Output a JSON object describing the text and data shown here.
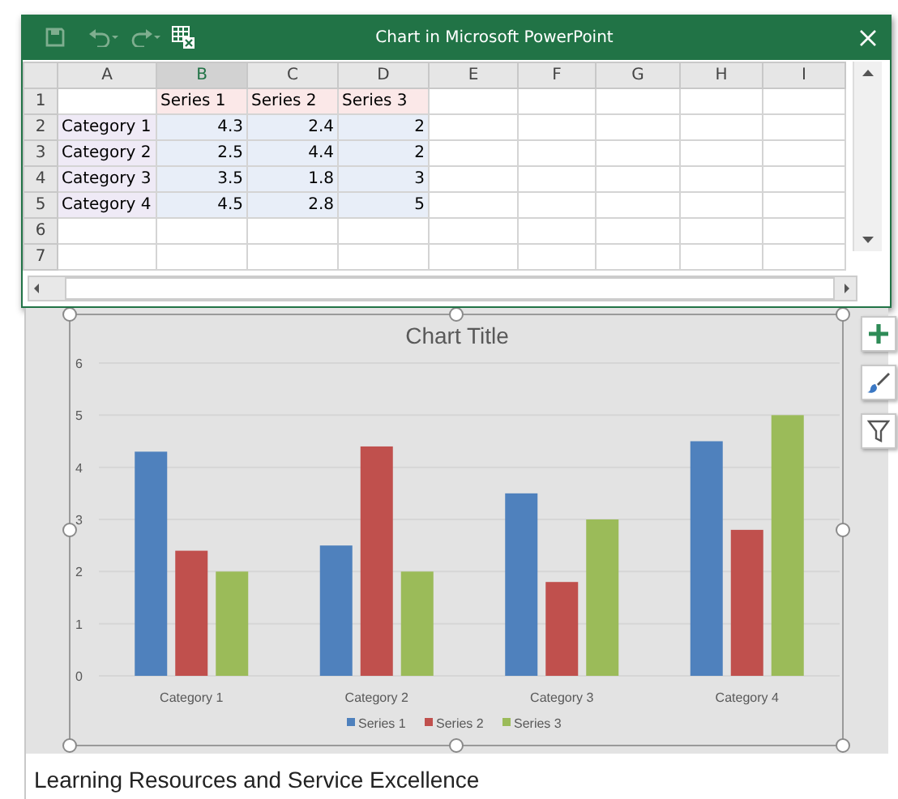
{
  "window": {
    "title": "Chart in Microsoft PowerPoint"
  },
  "sheet": {
    "columns": [
      {
        "label": "A",
        "selected": false
      },
      {
        "label": "B",
        "selected": true
      },
      {
        "label": "C",
        "selected": false
      },
      {
        "label": "D",
        "selected": false
      },
      {
        "label": "E",
        "selected": false
      },
      {
        "label": "F",
        "selected": false
      },
      {
        "label": "G",
        "selected": false
      },
      {
        "label": "H",
        "selected": false
      },
      {
        "label": "I",
        "selected": false
      }
    ],
    "rows": [
      {
        "number": "1",
        "cells": [
          "",
          "Series 1",
          "Series 2",
          "Series 3"
        ]
      },
      {
        "number": "2",
        "cells": [
          "Category 1",
          "4.3",
          "2.4",
          "2"
        ]
      },
      {
        "number": "3",
        "cells": [
          "Category 2",
          "2.5",
          "4.4",
          "2"
        ]
      },
      {
        "number": "4",
        "cells": [
          "Category 3",
          "3.5",
          "1.8",
          "3"
        ]
      },
      {
        "number": "5",
        "cells": [
          "Category 4",
          "4.5",
          "2.8",
          "5"
        ]
      },
      {
        "number": "6",
        "cells": []
      },
      {
        "number": "7",
        "cells": []
      }
    ]
  },
  "chart": {
    "chart_data": {
      "type": "bar",
      "title": "Chart Title",
      "categories": [
        "Category 1",
        "Category 2",
        "Category 3",
        "Category 4"
      ],
      "series": [
        {
          "name": "Series 1",
          "color": "#4f81bd",
          "values": [
            4.3,
            2.5,
            3.5,
            4.5
          ]
        },
        {
          "name": "Series 2",
          "color": "#c0504d",
          "values": [
            2.4,
            4.4,
            1.8,
            2.8
          ]
        },
        {
          "name": "Series 3",
          "color": "#9bbb59",
          "values": [
            2,
            2,
            3,
            5
          ]
        }
      ],
      "ylim": [
        0,
        6
      ],
      "yticks": [
        {
          "value": 0,
          "label": "0"
        },
        {
          "value": 1,
          "label": "1"
        },
        {
          "value": 2,
          "label": "2"
        },
        {
          "value": 3,
          "label": "3"
        },
        {
          "value": 4,
          "label": "4"
        },
        {
          "value": 5,
          "label": "5"
        },
        {
          "value": 6,
          "label": "6"
        }
      ],
      "grid": true,
      "legend": true
    }
  },
  "caption": "Learning Resources and Service Excellence"
}
